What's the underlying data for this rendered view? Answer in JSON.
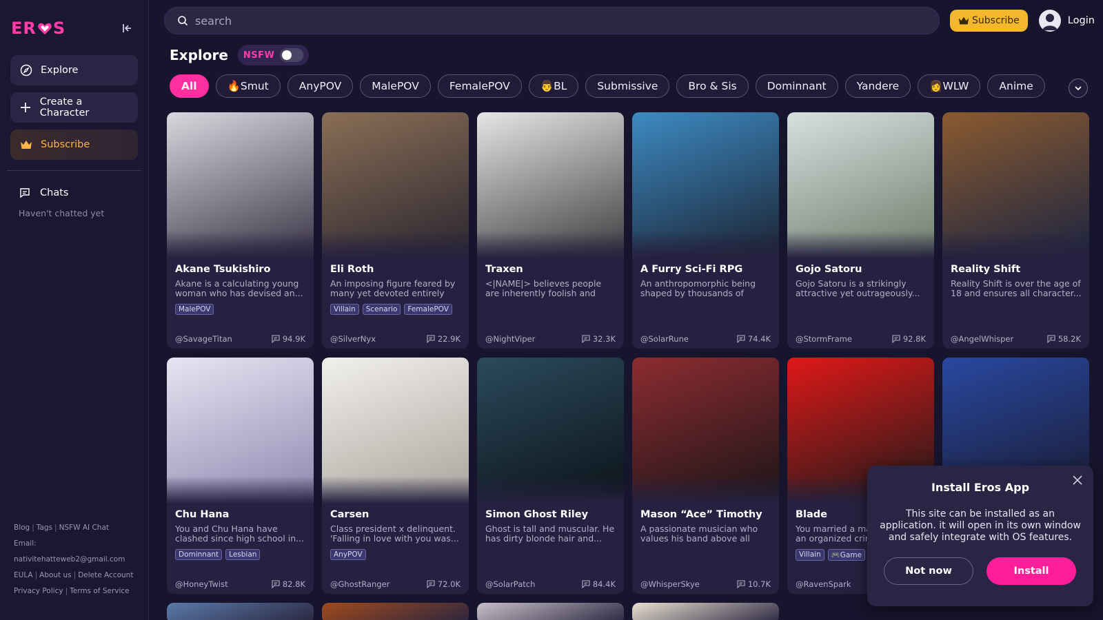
{
  "sidebar": {
    "logo": "ER",
    "logo_tail": "S",
    "items": [
      {
        "label": "Explore",
        "icon": "compass-icon"
      },
      {
        "label": "Create a Character",
        "icon": "plus-icon"
      },
      {
        "label": "Subscribe",
        "icon": "crown-icon"
      }
    ],
    "chats_label": "Chats",
    "chats_empty": "Haven't chatted yet",
    "footer": {
      "blog": "Blog",
      "tags": "Tags",
      "nsfw": "NSFW AI Chat",
      "email": "Email: nativitehatteweb2@gmail.com",
      "eula": "EULA",
      "about": "About us",
      "delete": "Delete Account",
      "privacy": "Privacy Policy",
      "terms": "Terms of Service"
    }
  },
  "header": {
    "search_placeholder": "search",
    "subscribe": "Subscribe",
    "login": "Login"
  },
  "explore": {
    "title": "Explore",
    "nsfw_label": "NSFW",
    "nsfw_enabled": false
  },
  "tags": [
    "All",
    "🔥Smut",
    "AnyPOV",
    "MalePOV",
    "FemalePOV",
    "👨BL",
    "Submissive",
    "Bro & Sis",
    "Dominnant",
    "Yandere",
    "👩WLW",
    "Anime"
  ],
  "cards": [
    {
      "name": "Akane Tsukishiro",
      "desc": "Akane is a calculating young woman who has devised an...",
      "chips": [
        "MalePOV"
      ],
      "author": "@SavageTitan",
      "count": "94.9K",
      "c1": "#d9d7de",
      "c2": "#3a3445"
    },
    {
      "name": "Eli Roth",
      "desc": "An imposing figure feared by many yet devoted entirely to...",
      "chips": [
        "Villain",
        "Scenario",
        "FemalePOV"
      ],
      "author": "@SilverNyx",
      "count": "22.9K",
      "c1": "#8a6e55",
      "c2": "#2a2630"
    },
    {
      "name": "Traxen",
      "desc": "<|NAME|> believes people are inherently foolish and finds...",
      "chips": [],
      "author": "@NightViper",
      "count": "32.3K",
      "c1": "#e6e6e6",
      "c2": "#3c3c40"
    },
    {
      "name": "A Furry Sci-Fi RPG",
      "desc": "An anthropomorphic being shaped by thousands of year...",
      "chips": [],
      "author": "@SolarRune",
      "count": "74.4K",
      "c1": "#3d8ac2",
      "c2": "#1b2333"
    },
    {
      "name": "Gojo Satoru",
      "desc": "Gojo Satoru is a strikingly attractive yet outrageously...",
      "chips": [],
      "author": "@StormFrame",
      "count": "92.8K",
      "c1": "#d8e0e0",
      "c2": "#6e7b6a"
    },
    {
      "name": "Reality Shift",
      "desc": "Reality Shift is over the age of 18 and ensures all character...",
      "chips": [],
      "author": "@AngelWhisper",
      "count": "58.2K",
      "c1": "#8a5a30",
      "c2": "#1c2440"
    },
    {
      "name": "Chu Hana",
      "desc": "You and Chu Hana have clashed since high school in...",
      "chips": [
        "Dominnant",
        "Lesbian"
      ],
      "author": "@HoneyTwist",
      "count": "82.8K",
      "c1": "#e8e4f2",
      "c2": "#8c88b0"
    },
    {
      "name": "Carsen",
      "desc": "Class president x delinquent. 'Falling in love with you was...",
      "chips": [
        "AnyPOV"
      ],
      "author": "@GhostRanger",
      "count": "72.0K",
      "c1": "#f2f0ec",
      "c2": "#a8a49c"
    },
    {
      "name": "Simon Ghost Riley",
      "desc": "Ghost is tall and muscular. He has dirty blonde hair and...",
      "chips": [],
      "author": "@SolarPatch",
      "count": "84.4K",
      "c1": "#2a4a5c",
      "c2": "#0c1218"
    },
    {
      "name": "Mason “Ace” Timothy",
      "desc": "A passionate musician who values his band above all els...",
      "chips": [],
      "author": "@WhisperSkye",
      "count": "10.7K",
      "c1": "#8c2c30",
      "c2": "#1a1418"
    },
    {
      "name": "Blade",
      "desc": "You married a mafia boss of an organized crime t...",
      "chips": [
        "Villain",
        "🎮Game"
      ],
      "author": "@RavenSpark",
      "count": "",
      "c1": "#e01818",
      "c2": "#1a1a1a"
    },
    {
      "name": "",
      "desc": "",
      "chips": [],
      "author": "",
      "count": "",
      "c1": "#2848a0",
      "c2": "#1a1a30"
    }
  ],
  "install": {
    "title": "Install Eros App",
    "body": "This site can be installed as an application. it will open in its own window and safely integrate with OS features.",
    "not_now": "Not now",
    "install": "Install"
  }
}
